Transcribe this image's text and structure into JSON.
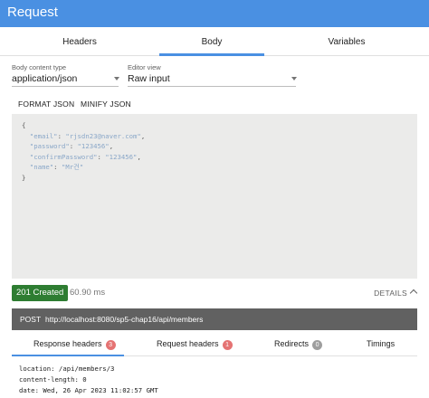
{
  "window": {
    "title": "Request"
  },
  "tabs": [
    {
      "label": "Headers"
    },
    {
      "label": "Body"
    },
    {
      "label": "Variables"
    }
  ],
  "body_settings": {
    "content_type_label": "Body content type",
    "content_type_value": "application/json",
    "editor_view_label": "Editor view",
    "editor_view_value": "Raw input",
    "format_json": "FORMAT JSON",
    "minify_json": "MINIFY JSON"
  },
  "editor": {
    "open": "{",
    "lines": [
      {
        "key": "\"email\"",
        "value": "\"rjsdn23@naver.com\"",
        "sep": ": ",
        "end": ","
      },
      {
        "key": "\"password\"",
        "value": "\"123456\"",
        "sep": ": ",
        "end": ","
      },
      {
        "key": "\"confirmPassword\"",
        "value": "\"123456\"",
        "sep": ": ",
        "end": ","
      },
      {
        "key": "\"name\"",
        "value": "\"Mr건\"",
        "sep": ": ",
        "end": ""
      }
    ],
    "close": "}"
  },
  "response": {
    "status": "201 Created",
    "time": "60.90 ms",
    "details_label": "DETAILS",
    "method": "POST",
    "url": "http://localhost:8080/sp5-chap16/api/members",
    "tabs": [
      {
        "label": "Response headers",
        "count": "3"
      },
      {
        "label": "Request headers",
        "count": "1"
      },
      {
        "label": "Redirects",
        "count": "0"
      },
      {
        "label": "Timings",
        "count": ""
      }
    ],
    "headers": [
      "location: /api/members/3",
      "content-length: 0",
      "date: Wed, 26 Apr 2023 11:02:57 GMT"
    ]
  },
  "colors": {
    "accent": "#4a90e2",
    "status_success": "#2e7d32",
    "badge_red": "#e57373",
    "badge_grey": "#9e9e9e"
  }
}
